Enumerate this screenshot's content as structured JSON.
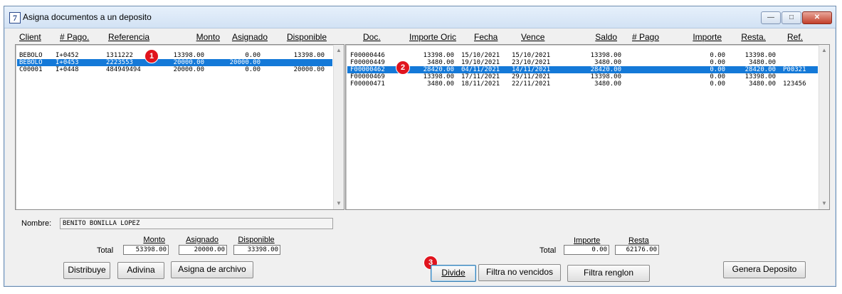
{
  "window": {
    "icon_glyph": "7",
    "title": "Asigna documentos a un deposito"
  },
  "title_buttons": {
    "minimize": "—",
    "maximize": "□",
    "close": "✕"
  },
  "left_table": {
    "headers": [
      "Client",
      "# Pago.",
      "Referencia",
      "Monto",
      "Asignado",
      "Disponible"
    ],
    "rows": [
      [
        "BEBOLO",
        "I+0452",
        "1311222",
        "13398.00",
        "0.00",
        "13398.00"
      ],
      [
        "BEBOLO",
        "I+0453",
        "2223553",
        "20000.00",
        "20000.00",
        ""
      ],
      [
        "C00001",
        "I+0448",
        "484949494",
        "20000.00",
        "0.00",
        "20000.00"
      ]
    ],
    "selected_row": 1
  },
  "right_table": {
    "headers": [
      "Doc.",
      "Importe Oric",
      "Fecha",
      "Vence",
      "Saldo",
      "# Pago",
      "Importe",
      "Resta.",
      "Ref."
    ],
    "rows": [
      [
        "F00000446",
        "13398.00",
        "15/10/2021",
        "15/10/2021",
        "13398.00",
        "",
        "0.00",
        "13398.00",
        ""
      ],
      [
        "F00000449",
        "3480.00",
        "19/10/2021",
        "23/10/2021",
        "3480.00",
        "",
        "0.00",
        "3480.00",
        ""
      ],
      [
        "F00000462",
        "28420.00",
        "04/11/2021",
        "14/11/2021",
        "28420.00",
        "",
        "0.00",
        "28420.00",
        "P00321"
      ],
      [
        "F00000469",
        "13398.00",
        "17/11/2021",
        "29/11/2021",
        "13398.00",
        "",
        "0.00",
        "13398.00",
        ""
      ],
      [
        "F00000471",
        "3480.00",
        "18/11/2021",
        "22/11/2021",
        "3480.00",
        "",
        "0.00",
        "3480.00",
        "123456"
      ]
    ],
    "selected_row": 2
  },
  "scroll_arrows": {
    "up": "▲",
    "down": "▼"
  },
  "nombre": {
    "label": "Nombre:",
    "value": "BENITO BONILLA LOPEZ"
  },
  "left_totals": {
    "label": "Total",
    "monto_header": "Monto",
    "asignado_header": "Asignado",
    "disponible_header": "Disponible",
    "monto": "53398.00",
    "asignado": "20000.00",
    "disponible": "33398.00"
  },
  "right_totals": {
    "label": "Total",
    "importe_header": "Importe",
    "resta_header": "Resta",
    "importe": "0.00",
    "resta": "62176.00"
  },
  "buttons": {
    "distribuye": "Distribuye",
    "adivina": "Adivina",
    "asigna_archivo": "Asigna de archivo",
    "divide": "Divide",
    "filtra_no_vencidos": "Filtra no vencidos",
    "filtra_renglon": "Filtra renglon",
    "genera_deposito": "Genera Deposito"
  },
  "markers": [
    "1",
    "2",
    "3"
  ],
  "colors": {
    "selection": "#1479d8",
    "marker": "#e0141e",
    "title_bar": "#d2e2f4"
  }
}
